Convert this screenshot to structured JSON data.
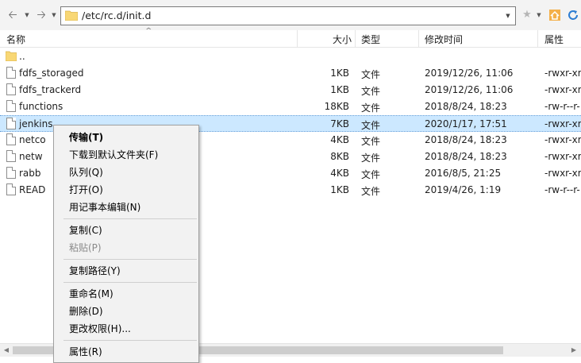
{
  "toolbar": {
    "address_path": "/etc/rc.d/init.d"
  },
  "header": {
    "name": "名称",
    "size": "大小",
    "type": "类型",
    "modified": "修改时间",
    "attributes": "属性"
  },
  "files": [
    {
      "name": "..",
      "size": "",
      "type": "",
      "modified": "",
      "attrs": "",
      "icon": "folder-icon"
    },
    {
      "name": "fdfs_storaged",
      "size": "1KB",
      "type": "文件",
      "modified": "2019/12/26, 11:06",
      "attrs": "-rwxr-xr",
      "icon": "file-icon"
    },
    {
      "name": "fdfs_trackerd",
      "size": "1KB",
      "type": "文件",
      "modified": "2019/12/26, 11:06",
      "attrs": "-rwxr-xr",
      "icon": "file-icon"
    },
    {
      "name": "functions",
      "size": "18KB",
      "type": "文件",
      "modified": "2018/8/24, 18:23",
      "attrs": "-rw-r--r-",
      "icon": "file-icon"
    },
    {
      "name": "jenkins",
      "size": "7KB",
      "type": "文件",
      "modified": "2020/1/17, 17:51",
      "attrs": "-rwxr-xr",
      "icon": "file-icon"
    },
    {
      "name": "netco",
      "size": "4KB",
      "type": "文件",
      "modified": "2018/8/24, 18:23",
      "attrs": "-rwxr-xr",
      "icon": "file-icon"
    },
    {
      "name": "netw",
      "size": "8KB",
      "type": "文件",
      "modified": "2018/8/24, 18:23",
      "attrs": "-rwxr-xr",
      "icon": "file-icon"
    },
    {
      "name": "rabb",
      "size": "4KB",
      "type": "文件",
      "modified": "2016/8/5, 21:25",
      "attrs": "-rwxr-xr",
      "icon": "file-icon"
    },
    {
      "name": "READ",
      "size": "1KB",
      "type": "文件",
      "modified": "2019/4/26, 1:19",
      "attrs": "-rw-r--r-",
      "icon": "file-icon"
    }
  ],
  "context_menu": {
    "transfer": "传输(T)",
    "download_default": "下载到默认文件夹(F)",
    "queue": "队列(Q)",
    "open": "打开(O)",
    "edit_notepad": "用记事本编辑(N)",
    "copy": "复制(C)",
    "paste": "粘贴(P)",
    "copy_path": "复制路径(Y)",
    "rename": "重命名(M)",
    "delete": "删除(D)",
    "change_perms": "更改权限(H)...",
    "properties": "属性(R)"
  },
  "colors": {
    "selection": "#cce8ff",
    "folder": "#f8d775",
    "menu_bg": "#f2f2f2"
  }
}
